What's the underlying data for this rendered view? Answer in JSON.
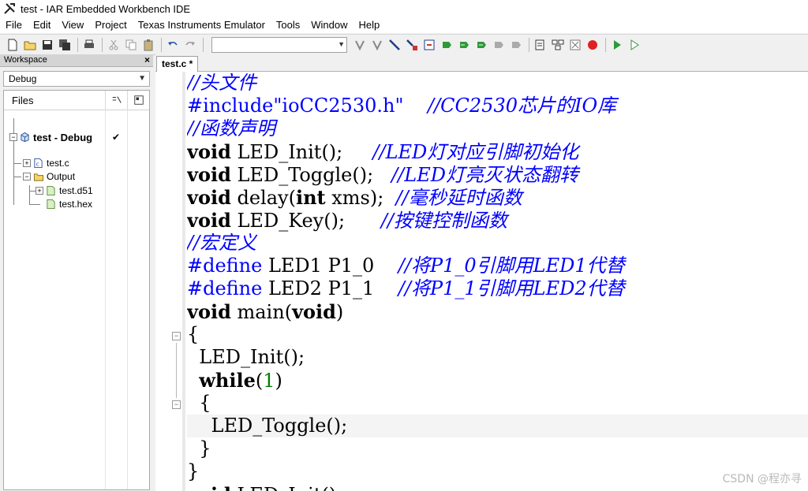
{
  "window": {
    "title": "test - IAR Embedded Workbench IDE"
  },
  "menu": [
    "File",
    "Edit",
    "View",
    "Project",
    "Texas Instruments Emulator",
    "Tools",
    "Window",
    "Help"
  ],
  "toolbar": {
    "combo_value": ""
  },
  "workspace": {
    "header": "Workspace",
    "close": "×",
    "config": "Debug",
    "files_col": "Files",
    "project": "test - Debug",
    "project_check": "✔",
    "items": [
      "test.c",
      "Output",
      "test.d51",
      "test.hex"
    ]
  },
  "editor": {
    "tab": "test.c *",
    "lines": [
      "//头文件",
      "#include\"ioCC2530.h\"    //CC2530芯片的IO库",
      "//函数声明",
      "void LED_Init();         //LED灯对应引脚初始化",
      "void LED_Toggle();       //LED灯亮灭状态翻转",
      "void delay(int xms);     //毫秒延时函数",
      "void LED_Key();          //按键控制函数",
      "//宏定义",
      "#define LED1 P1_0        //将P1_0引脚用LED1代替",
      "#define LED2 P1_1        //将P1_1引脚用LED2代替",
      "void main(void)",
      "{",
      "  LED_Init();",
      "  while(1)",
      "  {",
      "    LED_Toggle();",
      "  }",
      "}",
      "void LED_Init()"
    ]
  },
  "watermark": "CSDN @程亦寻",
  "colors": {
    "comment": "#0000ff",
    "number": "#008000",
    "keyword": "#000000"
  }
}
